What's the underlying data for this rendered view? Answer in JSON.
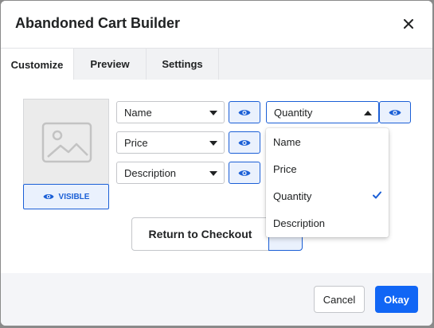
{
  "modal": {
    "title": "Abandoned Cart Builder"
  },
  "tabs": [
    {
      "label": "Customize",
      "active": true
    },
    {
      "label": "Preview",
      "active": false
    },
    {
      "label": "Settings",
      "active": false
    }
  ],
  "image_panel": {
    "visibility_label": "VISIBLE"
  },
  "fields": [
    {
      "selected": "Name"
    },
    {
      "selected": "Price"
    },
    {
      "selected": "Description"
    },
    {
      "selected": "Quantity",
      "open": true
    }
  ],
  "dropdown": {
    "options": [
      "Name",
      "Price",
      "Quantity",
      "Description"
    ],
    "checked": "Quantity"
  },
  "return_button": {
    "label": "Return to Checkout"
  },
  "footer": {
    "cancel_label": "Cancel",
    "okay_label": "Okay"
  },
  "colors": {
    "accent": "#1166f5",
    "accent_light": "#eaf1fd",
    "border": "#c4c6ca",
    "text": "#202223"
  },
  "icons": {
    "close": "close-icon",
    "eye": "eye-icon",
    "image_placeholder": "image-placeholder-icon",
    "check": "check-icon",
    "chevron": "chevron-down-icon"
  }
}
